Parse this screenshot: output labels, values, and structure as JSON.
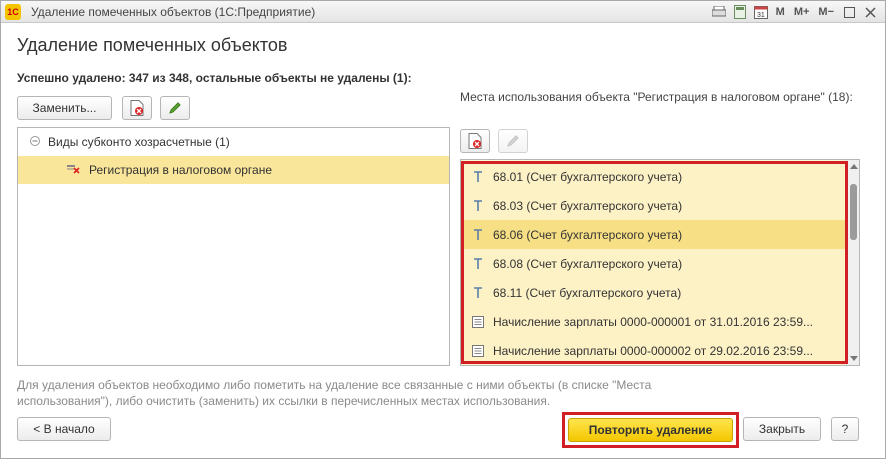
{
  "window": {
    "logo_text": "1С",
    "title": "Удаление помеченных объектов  (1С:Предприятие)",
    "titlebar_buttons": {
      "m": "M",
      "m_plus": "M+",
      "m_minus": "M−"
    }
  },
  "page": {
    "title": "Удаление помеченных объектов",
    "status": "Успешно удалено: 347 из 348, остальные объекты не удалены (1):"
  },
  "left_toolbar": {
    "replace_label": "Заменить..."
  },
  "tree": {
    "group_label": "Виды субконто хозрасчетные (1)",
    "item_label": "Регистрация в налоговом органе"
  },
  "right": {
    "header": "Места использования объекта \"Регистрация в налоговом органе\" (18):",
    "items": [
      {
        "label": "68.01 (Счет бухгалтерского учета)",
        "icon": "account-icon"
      },
      {
        "label": "68.03 (Счет бухгалтерского учета)",
        "icon": "account-icon"
      },
      {
        "label": "68.06 (Счет бухгалтерского учета)",
        "icon": "account-icon"
      },
      {
        "label": "68.08 (Счет бухгалтерского учета)",
        "icon": "account-icon"
      },
      {
        "label": "68.11 (Счет бухгалтерского учета)",
        "icon": "account-icon"
      },
      {
        "label": "Начисление зарплаты 0000-000001 от 31.01.2016 23:59...",
        "icon": "document-icon"
      },
      {
        "label": "Начисление зарплаты 0000-000002 от 29.02.2016 23:59...",
        "icon": "document-icon"
      }
    ]
  },
  "hint": "Для удаления объектов необходимо либо пометить на удаление все связанные с ними объекты (в списке \"Места использования\"), либо очистить (заменить) их ссылки в перечисленных местах использования.",
  "footer": {
    "back_label": "< В начало",
    "repeat_label": "Повторить удаление",
    "close_label": "Закрыть",
    "help_label": "?"
  },
  "colors": {
    "accent_yellow": "#f3c600",
    "selection": "#f9e69b",
    "highlight_frame": "#d11f26"
  }
}
